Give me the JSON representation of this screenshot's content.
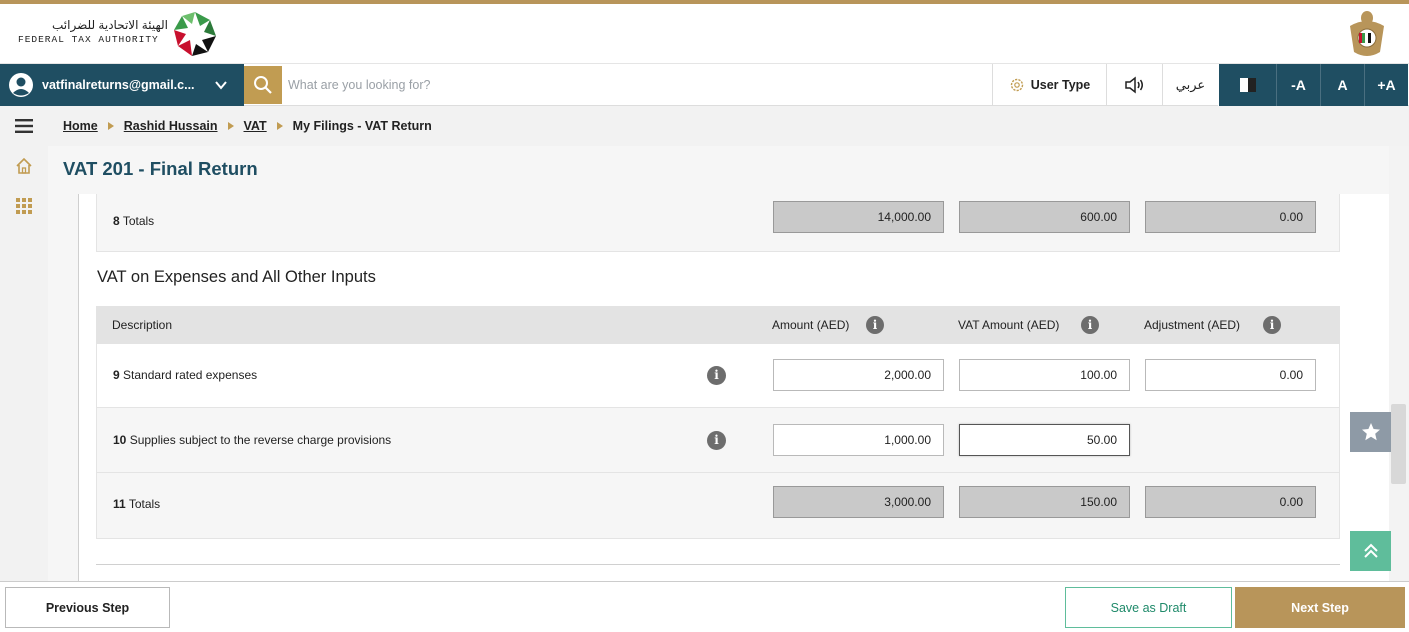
{
  "header": {
    "logo_arabic": "الهيئة الاتحادية للضرائب",
    "logo_english": "FEDERAL TAX AUTHORITY",
    "emblem_icon": "uae-emblem-icon",
    "brand_icon": "fta-logo-icon"
  },
  "toolbar": {
    "account_email": "vatfinalreturns@gmail.c...",
    "search_placeholder": "What are you looking for?",
    "user_type_label": "User Type",
    "language_label": "عربي",
    "font_decrease_label": "-A",
    "font_normal_label": "A",
    "font_increase_label": "+A"
  },
  "breadcrumb": {
    "items": [
      "Home",
      "Rashid Hussain",
      "VAT"
    ],
    "current": "My Filings - VAT Return"
  },
  "page": {
    "title": "VAT 201 - Final Return"
  },
  "supplies_totals": {
    "label_num": "8",
    "label": "Totals",
    "amount": "14,000.00",
    "vat_amount": "600.00",
    "adjustment": "0.00"
  },
  "expenses": {
    "heading": "VAT on Expenses and All Other Inputs",
    "columns": {
      "description": "Description",
      "amount": "Amount (AED)",
      "vat_amount": "VAT Amount (AED)",
      "adjustment": "Adjustment (AED)"
    },
    "rows": [
      {
        "num": "9",
        "label": "Standard rated expenses",
        "amount": "2,000.00",
        "vat_amount": "100.00",
        "adjustment": "0.00"
      },
      {
        "num": "10",
        "label": "Supplies subject to the reverse charge provisions",
        "amount": "1,000.00",
        "vat_amount": "50.00"
      }
    ],
    "totals": {
      "num": "11",
      "label": "Totals",
      "amount": "3,000.00",
      "vat_amount": "150.00",
      "adjustment": "0.00"
    }
  },
  "footer": {
    "previous_label": "Previous Step",
    "draft_label": "Save as Draft",
    "next_label": "Next Step"
  },
  "colors": {
    "brand_dark": "#1f4e62",
    "gold": "#b8955a",
    "green": "#5fbd9b"
  }
}
